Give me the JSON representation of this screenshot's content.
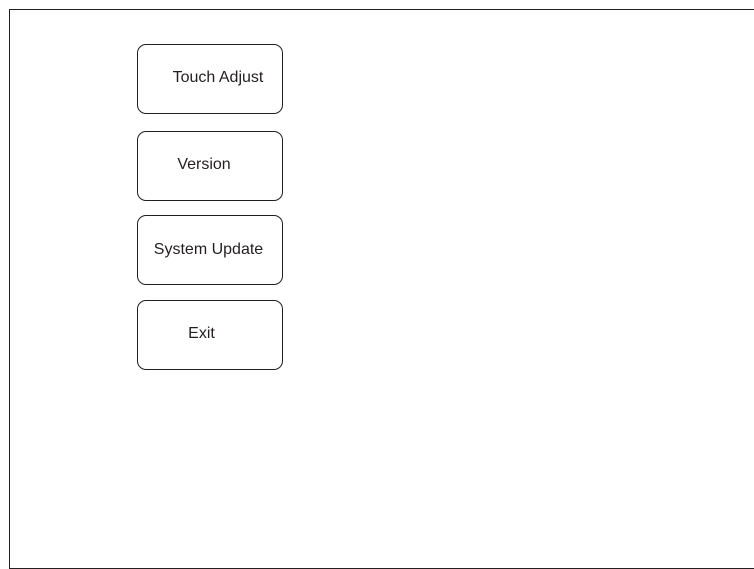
{
  "menu": {
    "items": [
      {
        "id": "touch_adjust",
        "label": "Touch Adjust"
      },
      {
        "id": "version",
        "label": "Version"
      },
      {
        "id": "system_update",
        "label": "System Update"
      },
      {
        "id": "exit",
        "label": "Exit"
      }
    ]
  },
  "colors": {
    "background": "#ffffff",
    "line": "#231f20",
    "text": "#231f20"
  }
}
